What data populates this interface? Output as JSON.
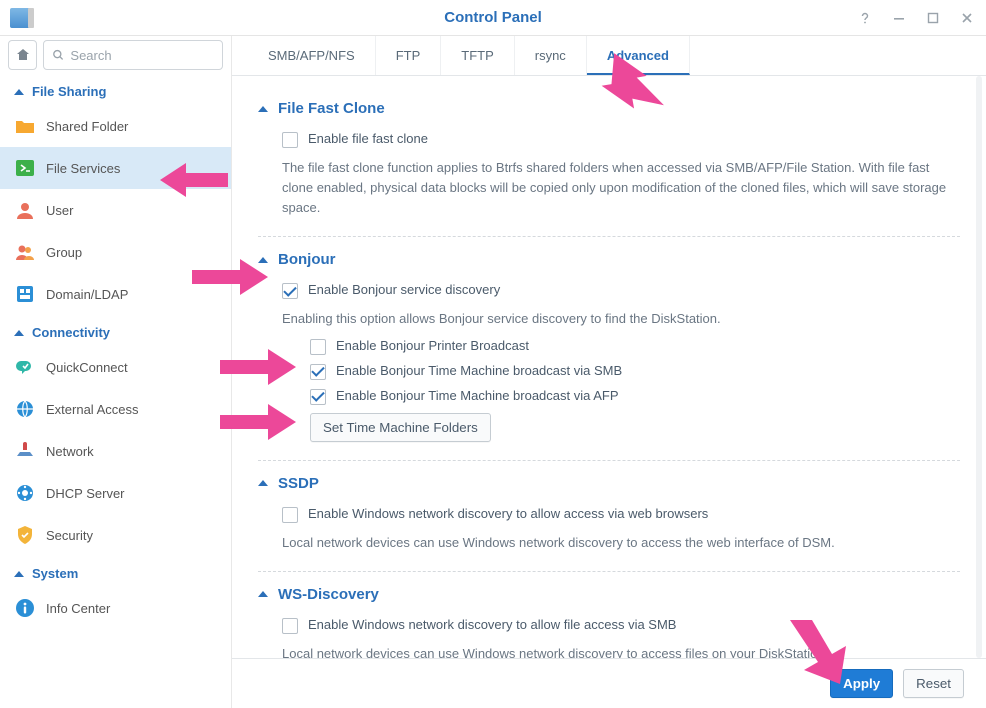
{
  "window": {
    "title": "Control Panel"
  },
  "search": {
    "placeholder": "Search"
  },
  "sidebar": {
    "sections": {
      "file_sharing": "File Sharing",
      "connectivity": "Connectivity",
      "system": "System"
    },
    "items": {
      "shared_folder": "Shared Folder",
      "file_services": "File Services",
      "user": "User",
      "group": "Group",
      "domain_ldap": "Domain/LDAP",
      "quickconnect": "QuickConnect",
      "external_access": "External Access",
      "network": "Network",
      "dhcp_server": "DHCP Server",
      "security": "Security",
      "info_center": "Info Center"
    }
  },
  "tabs": {
    "smb": "SMB/AFP/NFS",
    "ftp": "FTP",
    "tftp": "TFTP",
    "rsync": "rsync",
    "advanced": "Advanced"
  },
  "sections": {
    "file_fast_clone": {
      "title": "File Fast Clone",
      "enable": "Enable file fast clone",
      "enable_checked": false,
      "desc": "The file fast clone function applies to Btrfs shared folders when accessed via SMB/AFP/File Station. With file fast clone enabled, physical data blocks will be copied only upon modification of the cloned files, which will save storage space."
    },
    "bonjour": {
      "title": "Bonjour",
      "discovery": "Enable Bonjour service discovery",
      "discovery_checked": true,
      "desc": "Enabling this option allows Bonjour service discovery to find the DiskStation.",
      "printer": "Enable Bonjour Printer Broadcast",
      "printer_checked": false,
      "tm_smb": "Enable Bonjour Time Machine broadcast via SMB",
      "tm_smb_checked": true,
      "tm_afp": "Enable Bonjour Time Machine broadcast via AFP",
      "tm_afp_checked": true,
      "folders_btn": "Set Time Machine Folders"
    },
    "ssdp": {
      "title": "SSDP",
      "enable": "Enable Windows network discovery to allow access via web browsers",
      "enable_checked": false,
      "desc": "Local network devices can use Windows network discovery to access the web interface of DSM."
    },
    "wsd": {
      "title": "WS-Discovery",
      "enable": "Enable Windows network discovery to allow file access via SMB",
      "enable_checked": false,
      "desc": "Local network devices can use Windows network discovery to access files on your DiskStation."
    }
  },
  "footer": {
    "apply": "Apply",
    "reset": "Reset"
  },
  "colors": {
    "accent": "#2b6fb8",
    "pink": "#ec4899"
  }
}
